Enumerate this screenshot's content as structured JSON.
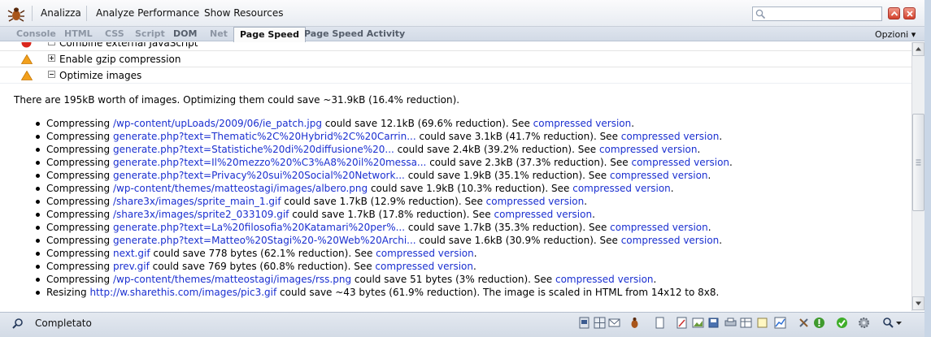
{
  "toolbar": {
    "analyze_label": "Analizza",
    "analyze_performance_label": "Analyze Performance",
    "show_resources_label": "Show Resources"
  },
  "tabs": [
    {
      "label": "Console"
    },
    {
      "label": "HTML"
    },
    {
      "label": "CSS"
    },
    {
      "label": "Script"
    },
    {
      "label": "DOM"
    },
    {
      "label": "Net"
    },
    {
      "label": "Page Speed"
    },
    {
      "label": "Page Speed Activity"
    }
  ],
  "active_tab": "Page Speed",
  "options_label": "Opzioni ▾",
  "rules": [
    {
      "status": "error",
      "label": "Combine external JavaScript",
      "expanded": true
    },
    {
      "status": "warning",
      "label": "Enable gzip compression",
      "expanded": false
    },
    {
      "status": "warning",
      "label": "Optimize images",
      "expanded": true
    }
  ],
  "summary": "There are 195kB worth of images. Optimizing them could save ~31.9kB (16.4% reduction).",
  "items": [
    {
      "prefix": "Compressing ",
      "link": "/wp-content/upLoads/2009/06/ie_patch.jpg",
      "middle": " could save 12.1kB (69.6% reduction). See ",
      "link2": "compressed version",
      "suffix": "."
    },
    {
      "prefix": "Compressing ",
      "link": "generate.php?text=Thematic%2C%20Hybrid%2C%20Carrin...",
      "middle": " could save 3.1kB (41.7% reduction). See ",
      "link2": "compressed version",
      "suffix": "."
    },
    {
      "prefix": "Compressing ",
      "link": "generate.php?text=Statistiche%20di%20diffusione%20...",
      "middle": " could save 2.4kB (39.2% reduction). See ",
      "link2": "compressed version",
      "suffix": "."
    },
    {
      "prefix": "Compressing ",
      "link": "generate.php?text=Il%20mezzo%20%C3%A8%20il%20messa...",
      "middle": " could save 2.3kB (37.3% reduction). See ",
      "link2": "compressed version",
      "suffix": "."
    },
    {
      "prefix": "Compressing ",
      "link": "generate.php?text=Privacy%20sui%20Social%20Network...",
      "middle": " could save 1.9kB (35.1% reduction). See ",
      "link2": "compressed version",
      "suffix": "."
    },
    {
      "prefix": "Compressing ",
      "link": "/wp-content/themes/matteostagi/images/albero.png",
      "middle": " could save 1.9kB (10.3% reduction). See ",
      "link2": "compressed version",
      "suffix": "."
    },
    {
      "prefix": "Compressing ",
      "link": "/share3x/images/sprite_main_1.gif",
      "middle": " could save 1.7kB (12.9% reduction). See ",
      "link2": "compressed version",
      "suffix": "."
    },
    {
      "prefix": "Compressing ",
      "link": "/share3x/images/sprite2_033109.gif",
      "middle": " could save 1.7kB (17.8% reduction). See ",
      "link2": "compressed version",
      "suffix": "."
    },
    {
      "prefix": "Compressing ",
      "link": "generate.php?text=La%20filosofia%20Katamari%20per%...",
      "middle": " could save 1.7kB (35.3% reduction). See ",
      "link2": "compressed version",
      "suffix": "."
    },
    {
      "prefix": "Compressing ",
      "link": "generate.php?text=Matteo%20Stagi%20-%20Web%20Archi...",
      "middle": " could save 1.6kB (30.9% reduction). See ",
      "link2": "compressed version",
      "suffix": "."
    },
    {
      "prefix": "Compressing ",
      "link": "next.gif",
      "middle": " could save 778 bytes (62.1% reduction). See ",
      "link2": "compressed version",
      "suffix": "."
    },
    {
      "prefix": "Compressing ",
      "link": "prev.gif",
      "middle": " could save 769 bytes (60.8% reduction). See ",
      "link2": "compressed version",
      "suffix": "."
    },
    {
      "prefix": "Compressing ",
      "link": "/wp-content/themes/matteostagi/images/rss.png",
      "middle": " could save 51 bytes (3% reduction). See ",
      "link2": "compressed version",
      "suffix": "."
    },
    {
      "prefix": "Resizing ",
      "link": "http://w.sharethis.com/images/pic3.gif",
      "middle": " could save ~43 bytes (61.9% reduction). The image is scaled in HTML from 14x12 to 8x8.",
      "link2": "",
      "suffix": ""
    }
  ],
  "status": {
    "text": "Completato",
    "icons": [
      "page-icon",
      "grid-icon",
      "mail-icon",
      "firebug-icon",
      "document-icon",
      "pencil-icon",
      "image-icon",
      "save-icon",
      "print-icon",
      "table-icon",
      "note-icon",
      "chart-icon",
      "tools-icon",
      "yslow-icon",
      "check-icon",
      "gear-icon",
      "zoom-icon"
    ]
  },
  "colors": {
    "link": "#1a2fd0",
    "error": "#d9261c",
    "warning": "#f2a01c",
    "check": "#3fae2a"
  }
}
